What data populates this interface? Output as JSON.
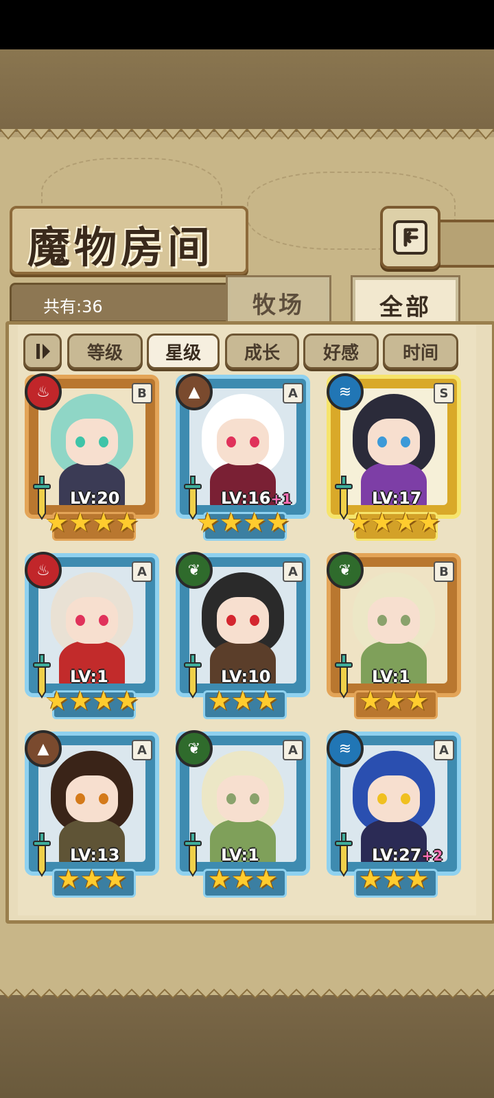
{
  "title": "魔物房间",
  "count_text": "共有:36",
  "tabs": [
    {
      "label": "牧场",
      "active": false
    },
    {
      "label": "全部",
      "active": true
    }
  ],
  "filters": [
    "等级",
    "星级",
    "成长",
    "好感",
    "时间"
  ],
  "active_filter": "星级",
  "colors": {
    "frame_blue": "#3e8bb0",
    "frame_gold": "#d9a929",
    "frame_bronze": "#b9772f",
    "star": "#ffcc2e",
    "plus_pink": "#ff6fb6"
  },
  "monsters": [
    {
      "element": "fire-icon",
      "rank": "B",
      "level": "LV:20",
      "plus": "",
      "stars": 4,
      "frame": "bronze"
    },
    {
      "element": "earth-icon",
      "rank": "A",
      "level": "LV:16",
      "plus": "+1",
      "stars": 4,
      "frame": "blue"
    },
    {
      "element": "water-icon",
      "rank": "S",
      "level": "LV:17",
      "plus": "",
      "stars": 4,
      "frame": "gold"
    },
    {
      "element": "fire-icon",
      "rank": "A",
      "level": "LV:1",
      "plus": "",
      "stars": 4,
      "frame": "blue"
    },
    {
      "element": "wood-icon",
      "rank": "A",
      "level": "LV:10",
      "plus": "",
      "stars": 3,
      "frame": "blue"
    },
    {
      "element": "wood-icon",
      "rank": "B",
      "level": "LV:1",
      "plus": "",
      "stars": 3,
      "frame": "bronze"
    },
    {
      "element": "earth-icon",
      "rank": "A",
      "level": "LV:13",
      "plus": "",
      "stars": 3,
      "frame": "blue"
    },
    {
      "element": "wood-icon",
      "rank": "A",
      "level": "LV:1",
      "plus": "",
      "stars": 3,
      "frame": "blue"
    },
    {
      "element": "water-icon",
      "rank": "A",
      "level": "LV:27",
      "plus": "+2",
      "stars": 3,
      "frame": "blue"
    }
  ]
}
